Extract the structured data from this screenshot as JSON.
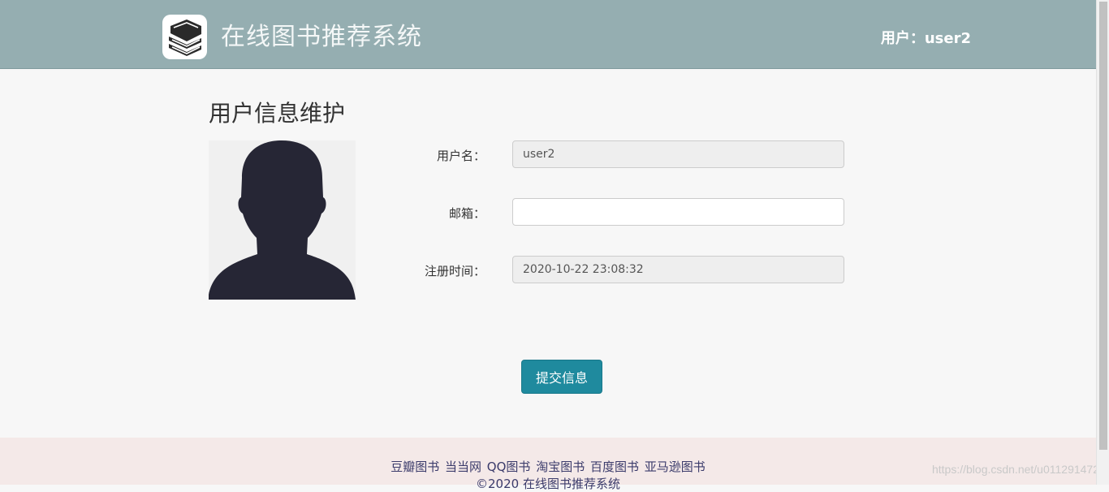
{
  "header": {
    "site_title": "在线图书推荐系统",
    "user_label": "用户：user2"
  },
  "page": {
    "title": "用户信息维护"
  },
  "form": {
    "username_label": "用户名：",
    "username_value": "user2",
    "email_label": "邮箱：",
    "email_value": "",
    "register_time_label": "注册时间：",
    "register_time_value": "2020-10-22 23:08:32",
    "submit_label": "提交信息"
  },
  "footer": {
    "links": [
      "豆瓣图书",
      "当当网",
      "QQ图书",
      "淘宝图书",
      "百度图书",
      "亚马逊图书"
    ],
    "copyright": "©2020 在线图书推荐系统"
  },
  "watermark": "https://blog.csdn.net/u011291472",
  "colors": {
    "header_bg": "#95aeb1",
    "button_bg": "#1f8a9e",
    "footer_bg": "#f4e9e8",
    "avatar_silhouette": "#262635"
  },
  "icons": {
    "logo": "books-icon",
    "avatar": "user-silhouette-icon"
  }
}
